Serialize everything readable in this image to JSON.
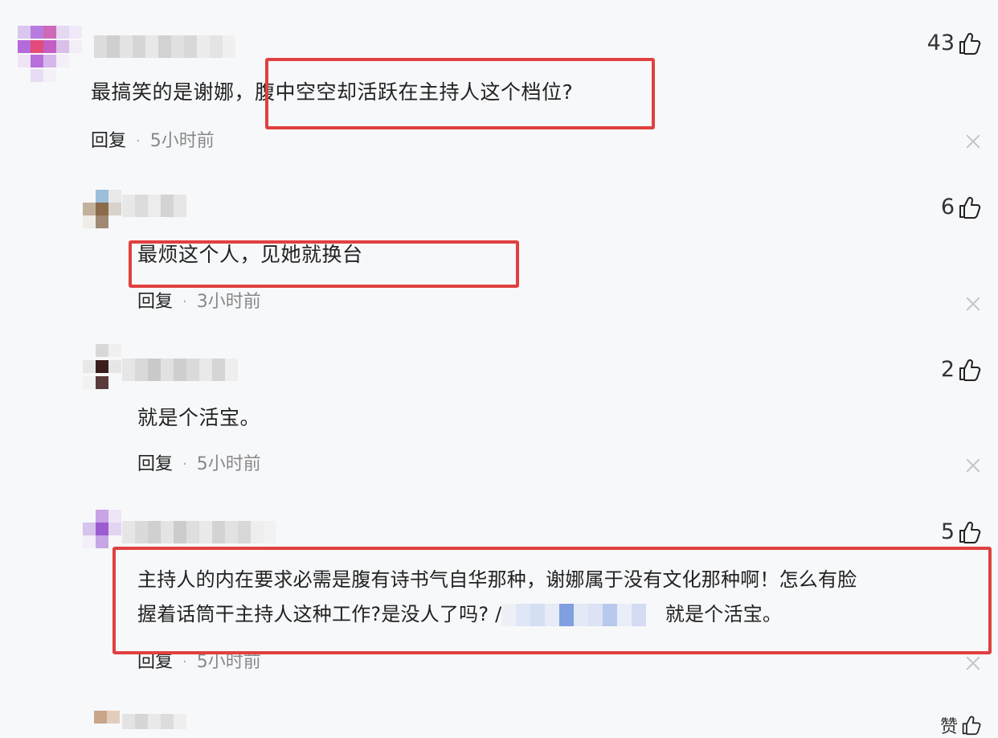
{
  "comments": [
    {
      "text": "最搞笑的是谢娜，腹中空空却活跃在主持人这个档位?",
      "reply_label": "回复",
      "separator": "·",
      "time": "5小时前",
      "likes": "43"
    },
    {
      "text": "最烦这个人，见她就换台",
      "reply_label": "回复",
      "separator": "·",
      "time": "3小时前",
      "likes": "6"
    },
    {
      "text": "就是个活宝。",
      "reply_label": "回复",
      "separator": "·",
      "time": "5小时前",
      "likes": "2"
    },
    {
      "text_line1": "主持人的内在要求必需是腹有诗书气自华那种，谢娜属于没有文化那种啊！怎么有脸",
      "text_line2_a": "握着话筒干主持人这种工作?是没人了吗? /",
      "text_line2_b": "就是个活宝。",
      "reply_label": "回复",
      "separator": "·",
      "time": "5小时前",
      "likes": "5"
    }
  ],
  "partial_next": {
    "likes": "赞"
  },
  "colors": {
    "highlight": "#e04040",
    "background": "#f7f8fa"
  },
  "icons": [
    "thumbs-up-icon",
    "close-icon"
  ]
}
